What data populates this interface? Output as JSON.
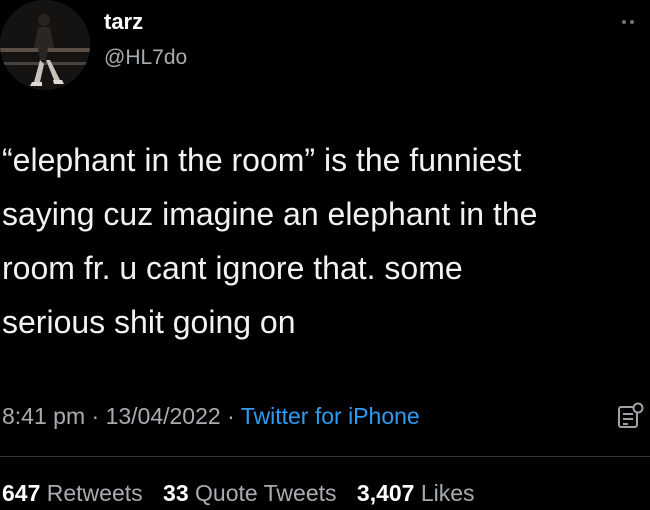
{
  "author": {
    "display_name": "tarz",
    "handle": "@HL7do"
  },
  "tweet": {
    "lines": [
      "“elephant in the room” is the funniest",
      "saying cuz imagine an elephant in the",
      "room fr. u cant ignore that. some",
      "serious shit going on"
    ]
  },
  "meta": {
    "time": "8:41 pm",
    "separator": " · ",
    "date": "13/04/2022",
    "source": "Twitter for iPhone"
  },
  "stats": {
    "retweets_count": "647",
    "retweets_label": "Retweets",
    "quotes_count": "33",
    "quotes_label": "Quote Tweets",
    "likes_count": "3,407",
    "likes_label": "Likes"
  },
  "icons": {
    "more": "more-dots-icon",
    "analytics": "analytics-icon"
  },
  "colors": {
    "background": "#000000",
    "text": "#ffffff",
    "secondary": "#a8acb0",
    "accent": "#2f9bf0",
    "divider": "#2f3336"
  }
}
